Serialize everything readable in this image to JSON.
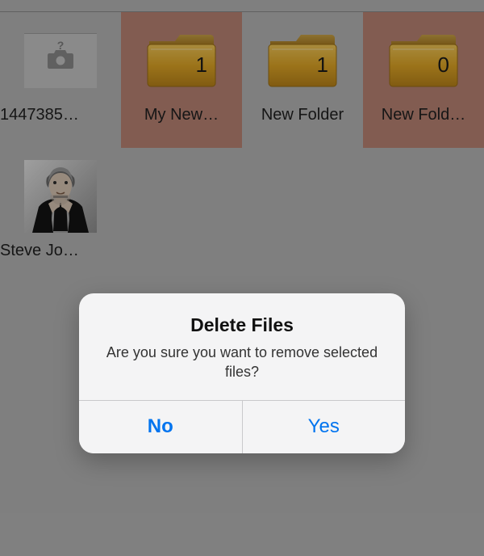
{
  "items": [
    {
      "label": "1447385…",
      "kind": "missing",
      "selected": false
    },
    {
      "label": "My New…",
      "kind": "folder",
      "count": "1",
      "selected": true
    },
    {
      "label": "New Folder",
      "kind": "folder",
      "count": "1",
      "selected": false
    },
    {
      "label": "New Fold…",
      "kind": "folder",
      "count": "0",
      "selected": true
    },
    {
      "label": "Steve Jo…",
      "kind": "image",
      "selected": false
    }
  ],
  "dialog": {
    "title": "Delete Files",
    "message": "Are you sure you want to remove selected files?",
    "no_label": "No",
    "yes_label": "Yes"
  },
  "colors": {
    "selection": "#bb8575",
    "accent": "#0174ef",
    "folder_light": "#e9b83f",
    "folder_dark": "#b8861a"
  }
}
